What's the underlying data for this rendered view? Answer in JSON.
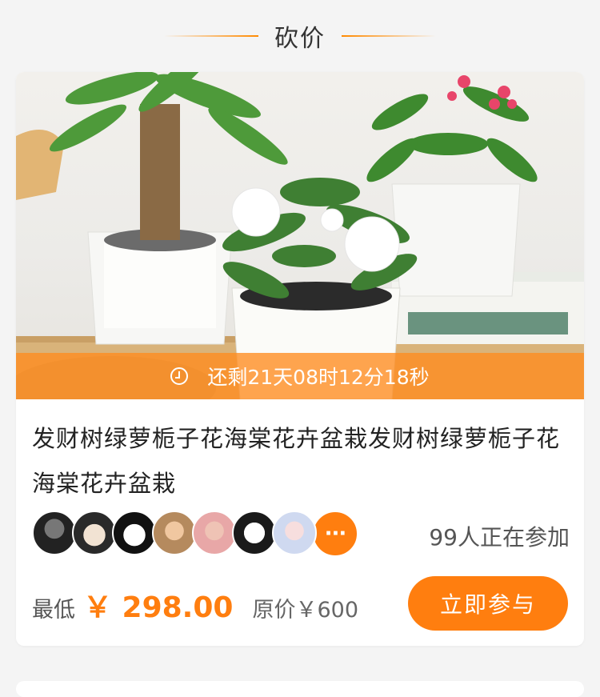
{
  "section": {
    "title": "砍价"
  },
  "product": {
    "countdown_text": "还剩21天08时12分18秒",
    "title": "发财树绿萝栀子花海棠花卉盆栽发财树绿萝栀子花海棠花卉盆栽",
    "participants_text": "99人正在参加",
    "price_label": "最低",
    "price_now": "￥ 298.00",
    "price_original": "原价￥600",
    "join_label": "立即参与",
    "more_icon": "···"
  },
  "colors": {
    "accent": "#ff7e0f",
    "header_line": "#ff8a00"
  },
  "avatar_count": 7
}
